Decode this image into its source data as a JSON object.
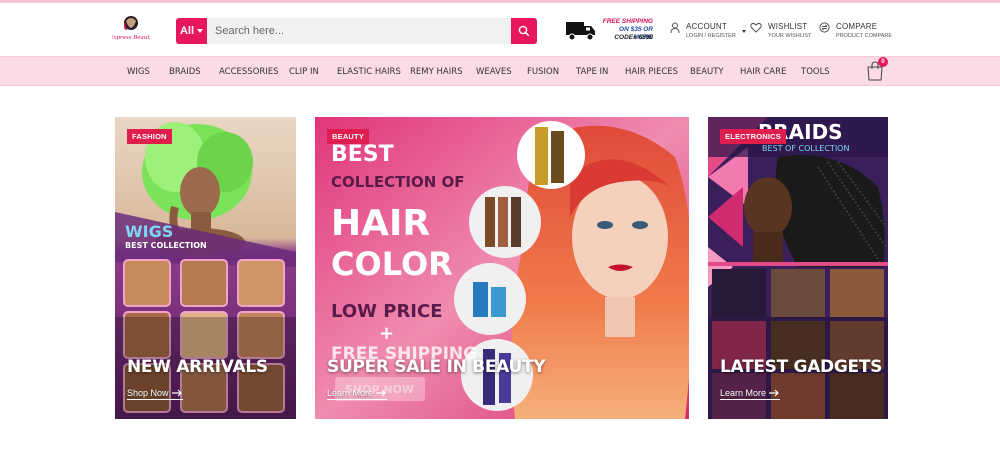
{
  "header": {
    "logo_text": "Express Beauty",
    "search": {
      "category_label": "All",
      "placeholder": "Search here..."
    },
    "shipping": {
      "line1": "FREE SHIPPING",
      "line2": "ON $35 OR MORE",
      "line3": "CODE# 6598"
    },
    "account": {
      "label": "ACCOUNT",
      "sublabel": "LOGIN / REGISTER"
    },
    "wishlist": {
      "label": "WISHLIST",
      "sublabel": "YOUR WISHLIST"
    },
    "compare": {
      "label": "COMPARE",
      "sublabel": "PRODUCT COMPARE"
    }
  },
  "nav": {
    "items": [
      "WIGS",
      "BRAIDS",
      "ACCESSORIES",
      "CLIP IN",
      "ELASTIC HAIRS",
      "REMY HAIRS",
      "WEAVES",
      "FUSION",
      "TAPE IN",
      "HAIR PIECES",
      "BEAUTY",
      "HAIR CARE",
      "TOOLS"
    ],
    "cart_count": "0"
  },
  "banners": [
    {
      "tag": "FASHION",
      "art_title": "WIGS",
      "art_subtitle": "BEST COLLECTION",
      "headline": "NEW ARRIVALS",
      "cta": "Shop Now"
    },
    {
      "tag": "BEAUTY",
      "art_lines": [
        "BEST",
        "COLLECTION OF",
        "HAIR",
        "COLOR",
        "LOW PRICE",
        "+",
        "FREE SHIPPING",
        "SHOP NOW"
      ],
      "headline": "SUPER SALE IN BEAUTY",
      "cta": "Learn More"
    },
    {
      "tag": "ELECTRONICS",
      "art_title": "BRAIDS",
      "art_subtitle": "BEST OF COLLECTION",
      "headline": "LATEST GADGETS",
      "cta": "Learn More"
    }
  ],
  "colors": {
    "accent": "#e8175d",
    "nav_bg": "#fbdce4",
    "tag_bg": "#e01e4e"
  }
}
